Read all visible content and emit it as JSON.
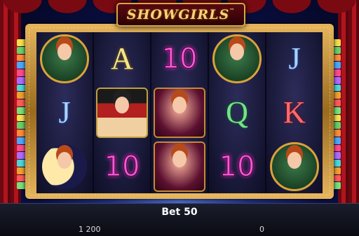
{
  "game": {
    "title": "SHOWGIRLS",
    "title_mark": "™"
  },
  "reels": [
    [
      "redhead-lounge",
      "J",
      "showgirl-moon"
    ],
    [
      "A",
      "showgirl-hat",
      "10"
    ],
    [
      "10",
      "brunette",
      "brunette"
    ],
    [
      "redhead-lounge",
      "Q",
      "10"
    ],
    [
      "J",
      "K",
      "redhead-lounge"
    ]
  ],
  "symbol_icons": {
    "redhead-lounge": "redhead-icon",
    "showgirl-moon": "moon-girl-icon",
    "showgirl-hat": "hat-girl-icon",
    "brunette": "brunette-icon"
  },
  "side_lines": [],
  "bottom": {
    "bet_label": "Bet 50",
    "credit": "1 200",
    "win": "0"
  },
  "colors": {
    "frame_gold": "#d9a23a",
    "curtain_red": "#b0141e",
    "ten_pink": "#ff56d8"
  }
}
